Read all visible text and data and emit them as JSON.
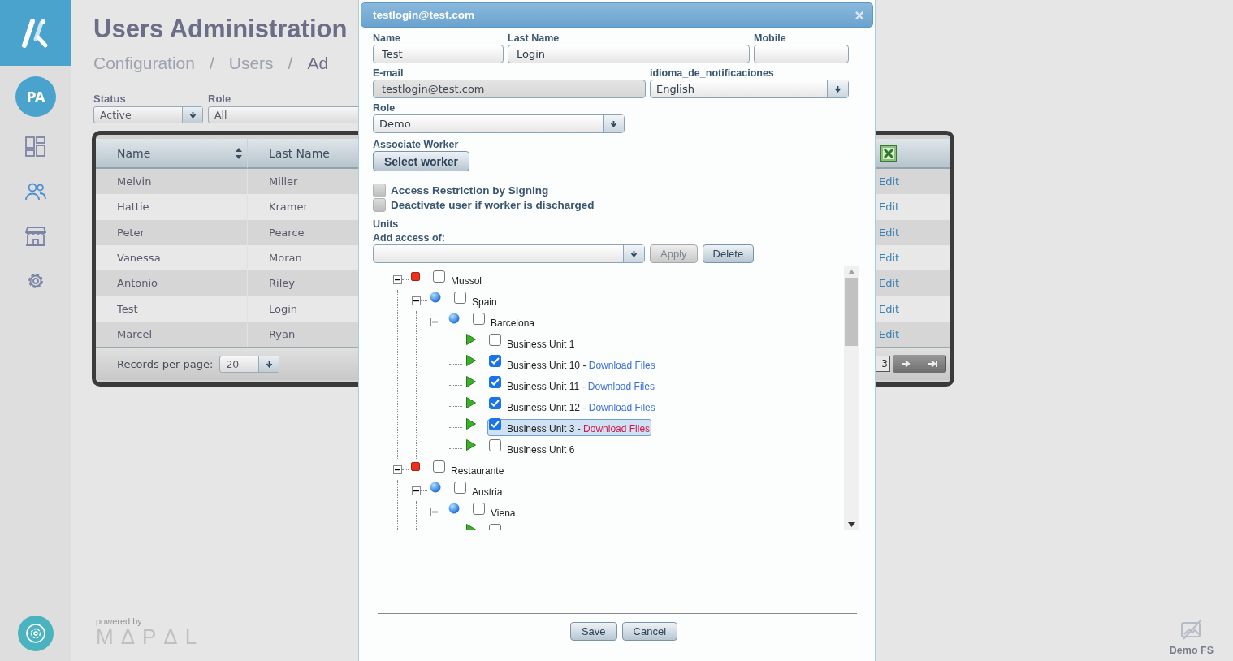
{
  "app": {
    "user_initials": "PA"
  },
  "sidebar": {
    "items": [
      {
        "kind": "dashboard",
        "selected": false
      },
      {
        "kind": "users",
        "selected": true
      },
      {
        "kind": "store",
        "selected": false
      },
      {
        "kind": "settings",
        "selected": false
      }
    ]
  },
  "page": {
    "title": "Users Administration",
    "breadcrumb": [
      {
        "kind": "link",
        "label": "Configuration"
      },
      {
        "kind": "separator",
        "label": "/"
      },
      {
        "kind": "link",
        "label": "Users"
      },
      {
        "kind": "separator",
        "label": "/"
      },
      {
        "kind": "current",
        "label": "Ad"
      }
    ]
  },
  "filters": [
    {
      "label": "Status",
      "value": "Active"
    },
    {
      "label": "Role",
      "value": "All"
    }
  ],
  "table": {
    "columns": [
      "Name",
      "Last Name"
    ],
    "rows": [
      {
        "cells": [
          "Melvin",
          "Miller"
        ],
        "action": "Edit"
      },
      {
        "cells": [
          "Hattie",
          "Kramer"
        ],
        "action": "Edit"
      },
      {
        "cells": [
          "Peter",
          "Pearce"
        ],
        "action": "Edit"
      },
      {
        "cells": [
          "Vanessa",
          "Moran"
        ],
        "action": "Edit"
      },
      {
        "cells": [
          "Antonio",
          "Riley"
        ],
        "action": "Edit"
      },
      {
        "cells": [
          "Test",
          "Login"
        ],
        "action": "Edit"
      },
      {
        "cells": [
          "Marcel",
          "Ryan"
        ],
        "action": "Edit"
      }
    ],
    "footer": {
      "records_label": "Records per page:",
      "records_value": "20",
      "page": "3"
    }
  },
  "dialog": {
    "title": "testlogin@test.com",
    "close": "×",
    "name": {
      "label": "Name",
      "value": "Test"
    },
    "last_name": {
      "label": "Last Name",
      "value": "Login"
    },
    "mobile": {
      "label": "Mobile"
    },
    "email": {
      "label": "E-mail",
      "value": "testlogin@test.com",
      "disabled": true
    },
    "language": {
      "label": "idioma_de_notificaciones",
      "value": "English"
    },
    "role": {
      "label": "Role",
      "value": "Demo"
    },
    "associate_worker": {
      "label": "Associate Worker",
      "button": "Select worker"
    },
    "options": [
      {
        "label": "Access Restriction by Signing",
        "checked": false
      },
      {
        "label": "Deactivate user if worker is discharged",
        "checked": false
      }
    ],
    "units_label": "Units",
    "add_access": {
      "label": "Add access of:",
      "buttons": [
        {
          "label": "Apply",
          "disabled": true
        },
        {
          "label": "Delete",
          "disabled": false
        }
      ]
    },
    "tree": [
      {
        "kind": "company",
        "label": "Mussol",
        "checked": false,
        "expanded": true,
        "children": [
          {
            "kind": "region",
            "label": "Spain",
            "checked": false,
            "expanded": true,
            "children": [
              {
                "kind": "region",
                "label": "Barcelona",
                "checked": false,
                "expanded": true,
                "children": [
                  {
                    "kind": "unit",
                    "label": "Business Unit 1",
                    "checked": false,
                    "selected": false
                  },
                  {
                    "kind": "unit",
                    "label": "Business Unit 10 -",
                    "link": "Download Files",
                    "checked": true,
                    "selected": false
                  },
                  {
                    "kind": "unit",
                    "label": "Business Unit 11 -",
                    "link": "Download Files",
                    "checked": true,
                    "selected": false
                  },
                  {
                    "kind": "unit",
                    "label": "Business Unit 12 -",
                    "link": "Download Files",
                    "checked": true,
                    "selected": false
                  },
                  {
                    "kind": "unit",
                    "label": "Business Unit 3 -",
                    "link": "Download Files",
                    "checked": true,
                    "selected": true
                  },
                  {
                    "kind": "unit",
                    "label": "Business Unit 6",
                    "checked": false,
                    "selected": false
                  }
                ]
              }
            ]
          }
        ]
      },
      {
        "kind": "company",
        "label": "Restaurante",
        "checked": false,
        "expanded": true,
        "children": [
          {
            "kind": "region",
            "label": "Austria",
            "checked": false,
            "expanded": true,
            "children": [
              {
                "kind": "region",
                "label": "Viena",
                "checked": false,
                "expanded": true,
                "children": [
                  {
                    "kind": "unit",
                    "checked": false
                  }
                ]
              }
            ]
          }
        ]
      }
    ],
    "actions": [
      "Save",
      "Cancel"
    ]
  },
  "footer": {
    "powered_by": "powered by",
    "brand": "MΔPΔL",
    "environment": "Demo FS"
  }
}
